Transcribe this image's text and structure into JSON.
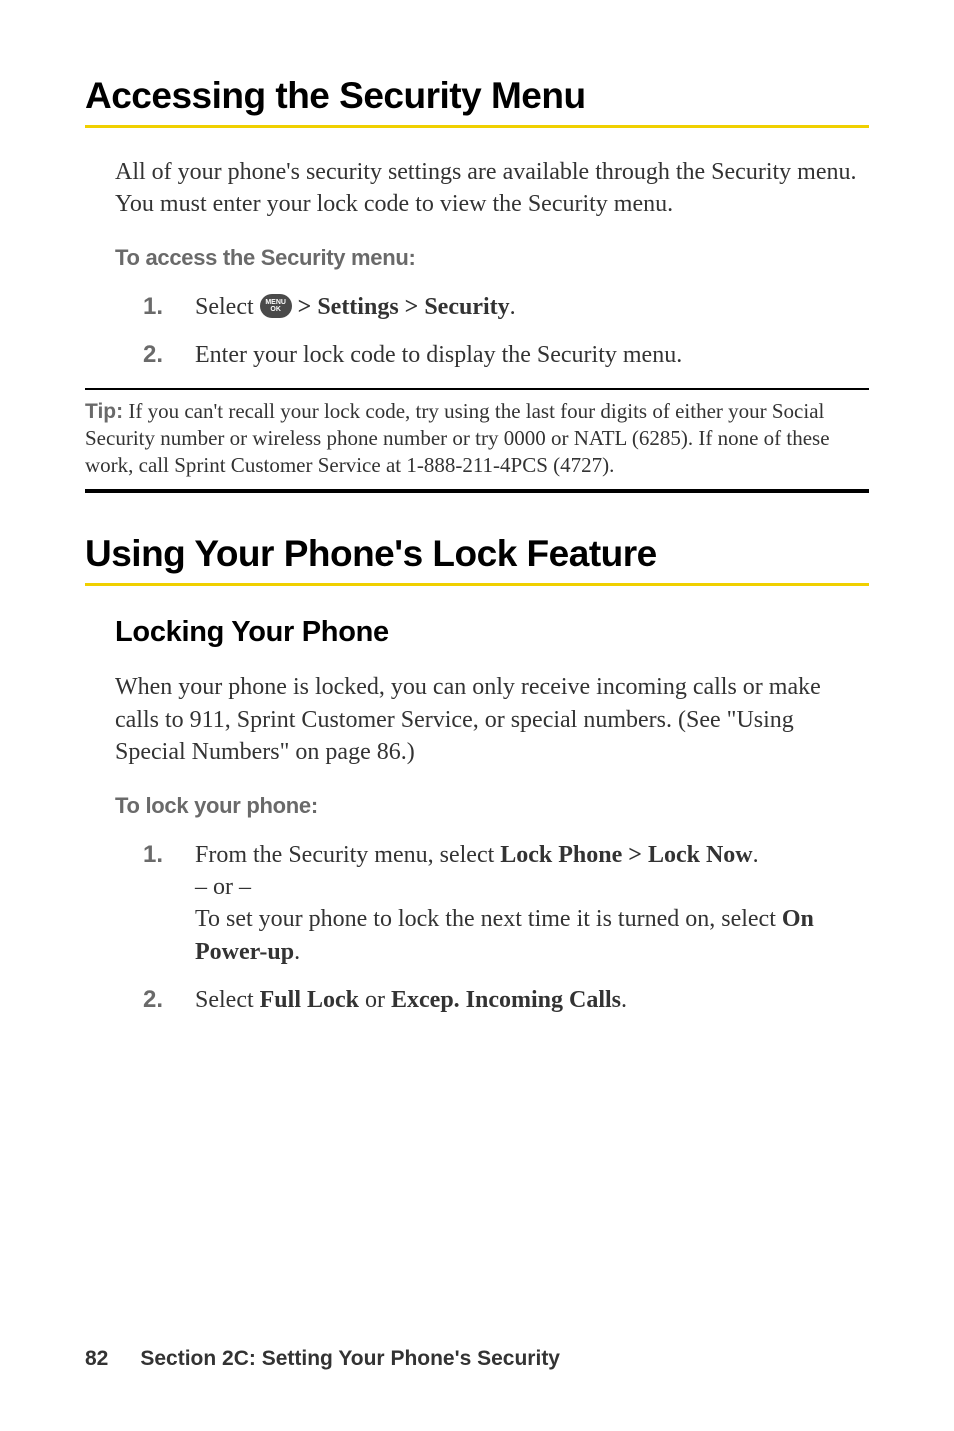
{
  "section1": {
    "heading": "Accessing the Security Menu",
    "intro": "All of your phone's security settings are available through the Security menu. You must enter your lock code to view the Security menu.",
    "subheading": "To access the Security menu:",
    "step1": {
      "num": "1.",
      "prefix": "Select ",
      "iconLabel": "MENU\nOK",
      "suffix": " > Settings > Security",
      "period": "."
    },
    "step2": {
      "num": "2.",
      "text": "Enter your lock code to display the Security menu."
    },
    "tip": {
      "label": "Tip:",
      "text": " If you can't recall your lock code, try using the last four digits of either your Social Security number or wireless phone number or try 0000 or NATL (6285). If none of these work, call Sprint Customer Service at 1-888-211-4PCS (4727)."
    }
  },
  "section2": {
    "heading": "Using Your Phone's Lock Feature",
    "sub": {
      "heading": "Locking Your Phone",
      "intro": "When your phone is locked, you can only receive incoming calls or make calls to 911, Sprint Customer Service, or special numbers. (See \"Using Special Numbers\" on page 86.)",
      "subheading": "To lock your phone:",
      "step1": {
        "num": "1.",
        "line1a": "From the Security menu, select ",
        "line1b": "Lock Phone > Lock Now",
        "line1c": ".",
        "or": "– or –",
        "line2a": "To set your phone to lock the next time it is turned on, select ",
        "line2b": "On Power-up",
        "line2c": "."
      },
      "step2": {
        "num": "2.",
        "a": "Select ",
        "b": "Full Lock",
        "c": " or ",
        "d": "Excep. Incoming Calls",
        "e": "."
      }
    }
  },
  "footer": {
    "page": "82",
    "section": "Section 2C: Setting Your Phone's Security"
  }
}
